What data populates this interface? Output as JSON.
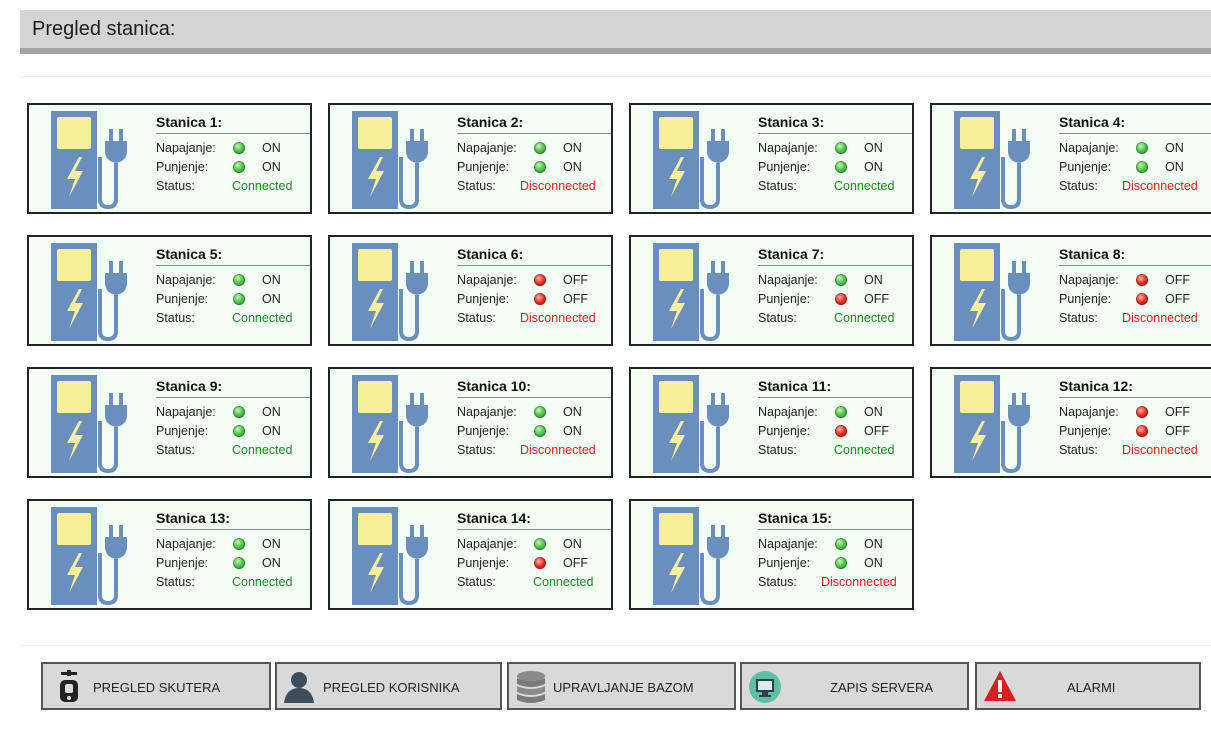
{
  "header": {
    "title": "Pregled stanica:"
  },
  "labels": {
    "napajanje": "Napajanje:",
    "punjenje": "Punjenje:",
    "status": "Status:"
  },
  "stations": [
    {
      "name": "Stanica 1:",
      "napajanje": "ON",
      "punjenje": "ON",
      "status": "Connected"
    },
    {
      "name": "Stanica 2:",
      "napajanje": "ON",
      "punjenje": "ON",
      "status": "Disconnected"
    },
    {
      "name": "Stanica 3:",
      "napajanje": "ON",
      "punjenje": "ON",
      "status": "Connected"
    },
    {
      "name": "Stanica 4:",
      "napajanje": "ON",
      "punjenje": "ON",
      "status": "Disconnected"
    },
    {
      "name": "Stanica 5:",
      "napajanje": "ON",
      "punjenje": "ON",
      "status": "Connected"
    },
    {
      "name": "Stanica 6:",
      "napajanje": "OFF",
      "punjenje": "OFF",
      "status": "Disconnected"
    },
    {
      "name": "Stanica 7:",
      "napajanje": "ON",
      "punjenje": "OFF",
      "status": "Connected"
    },
    {
      "name": "Stanica 8:",
      "napajanje": "OFF",
      "punjenje": "OFF",
      "status": "Disconnected"
    },
    {
      "name": "Stanica 9:",
      "napajanje": "ON",
      "punjenje": "ON",
      "status": "Connected"
    },
    {
      "name": "Stanica 10:",
      "napajanje": "ON",
      "punjenje": "ON",
      "status": "Disconnected"
    },
    {
      "name": "Stanica 11:",
      "napajanje": "ON",
      "punjenje": "OFF",
      "status": "Connected"
    },
    {
      "name": "Stanica 12:",
      "napajanje": "OFF",
      "punjenje": "OFF",
      "status": "Disconnected"
    },
    {
      "name": "Stanica 13:",
      "napajanje": "ON",
      "punjenje": "ON",
      "status": "Connected"
    },
    {
      "name": "Stanica 14:",
      "napajanje": "ON",
      "punjenje": "OFF",
      "status": "Connected"
    },
    {
      "name": "Stanica 15:",
      "napajanje": "ON",
      "punjenje": "ON",
      "status": "Disconnected"
    }
  ],
  "nav": [
    {
      "label": "PREGLED SKUTERA",
      "icon": "scooter-icon"
    },
    {
      "label": "PREGLED KORISNIKA",
      "icon": "user-icon"
    },
    {
      "label": "UPRAVLJANJE BAZOM",
      "icon": "database-icon"
    },
    {
      "label": "ZAPIS SERVERA",
      "icon": "monitor-icon"
    },
    {
      "label": "ALARMI",
      "icon": "warning-icon"
    }
  ],
  "colors": {
    "card_bg": "#f2fdf4",
    "pump_blue": "#6b8fbd",
    "pump_screen": "#f8ef9c",
    "connected": "#1f8a22",
    "disconnected": "#e02020",
    "led_on": "#4ec64a",
    "led_off": "#e8281a"
  }
}
